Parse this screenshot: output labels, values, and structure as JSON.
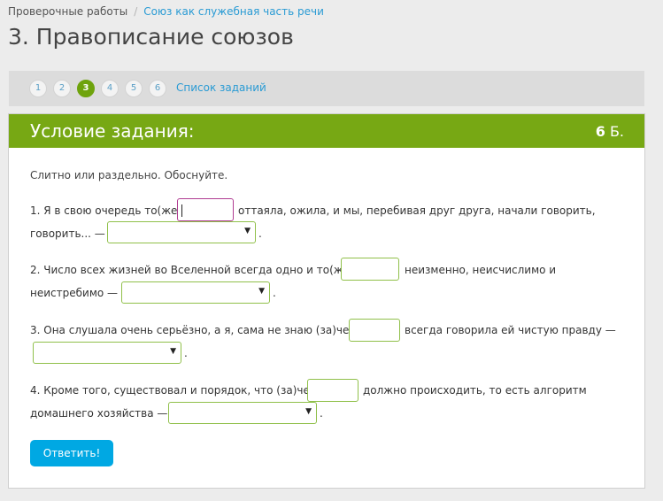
{
  "breadcrumb": {
    "root": "Проверочные работы",
    "separator": "/",
    "current": "Союз как служебная часть речи"
  },
  "page_title": "3. Правописание союзов",
  "pager": {
    "pages": [
      "1",
      "2",
      "3",
      "4",
      "5",
      "6"
    ],
    "active_page": "3",
    "tasks_link": "Список заданий"
  },
  "panel": {
    "title": "Условие задания:",
    "score_value": "6",
    "score_unit": "Б.",
    "instruction": "Слитно или раздельно. Обоснуйте.",
    "items": [
      {
        "before": "1. Я в свою очередь то(же)",
        "after": "оттаяла, ожила, и мы, перебивая друг друга, начали говорить,",
        "line2": "говорить... —",
        "input_value": "",
        "select_value": "",
        "end": "."
      },
      {
        "before": "2. Число всех жизней во Вселенной всегда одно и то(же)",
        "after": "неизменно, неисчислимо и",
        "line2": "неистребимо —",
        "input_value": "",
        "select_value": "",
        "end": "."
      },
      {
        "before": "3. Она слушала очень серьёзно, а я, сама не знаю (за)чем,",
        "after": "всегда говорила ей чистую правду —",
        "line2": "",
        "input_value": "",
        "select_value": "",
        "end": "."
      },
      {
        "before": "4. Кроме того, существовал и порядок, что (за)чем",
        "after": "должно происходить, то есть алгоритм",
        "line2": "домашнего хозяйства —",
        "input_value": "",
        "select_value": "",
        "end": "."
      }
    ],
    "submit_label": "Ответить!"
  },
  "colors": {
    "accent_green": "#77a814",
    "active_page": "#6ea30c",
    "link_blue": "#2a9bd4",
    "button_blue": "#00a8e3",
    "focus_border": "#b03c92",
    "input_border": "#90c04a"
  },
  "icons": {
    "select_arrow": "dropdown-arrow-icon",
    "pager_shape": "circle"
  }
}
